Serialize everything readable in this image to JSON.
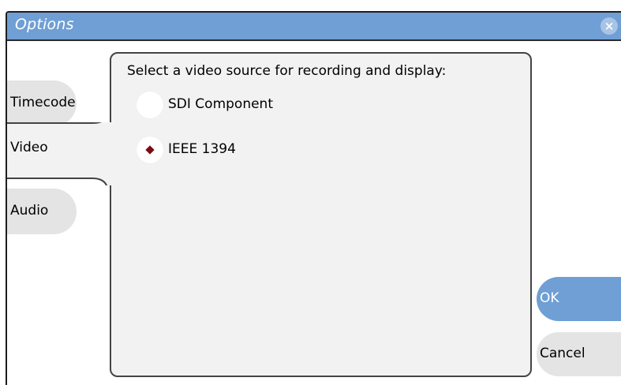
{
  "window": {
    "title": "Options",
    "close_glyph": "×"
  },
  "tabs": [
    {
      "label": "Timecode",
      "active": false
    },
    {
      "label": "Video",
      "active": true
    },
    {
      "label": "Audio",
      "active": false
    }
  ],
  "panel": {
    "prompt": "Select a video source for recording and display:",
    "options": [
      {
        "label": "SDI Component",
        "selected": false
      },
      {
        "label": "IEEE 1394",
        "selected": true
      }
    ]
  },
  "buttons": {
    "ok_label": "OK",
    "cancel_label": "Cancel"
  },
  "colors": {
    "titlebar": "#6f9fd4",
    "ok_button": "#6f9fd4",
    "tab_inactive": "#e4e4e4",
    "panel": "#f2f2f2",
    "selected_dot": "#7a0d12"
  },
  "icons": {
    "close": "close-icon",
    "selected_radio": "diamond-dot-icon"
  }
}
